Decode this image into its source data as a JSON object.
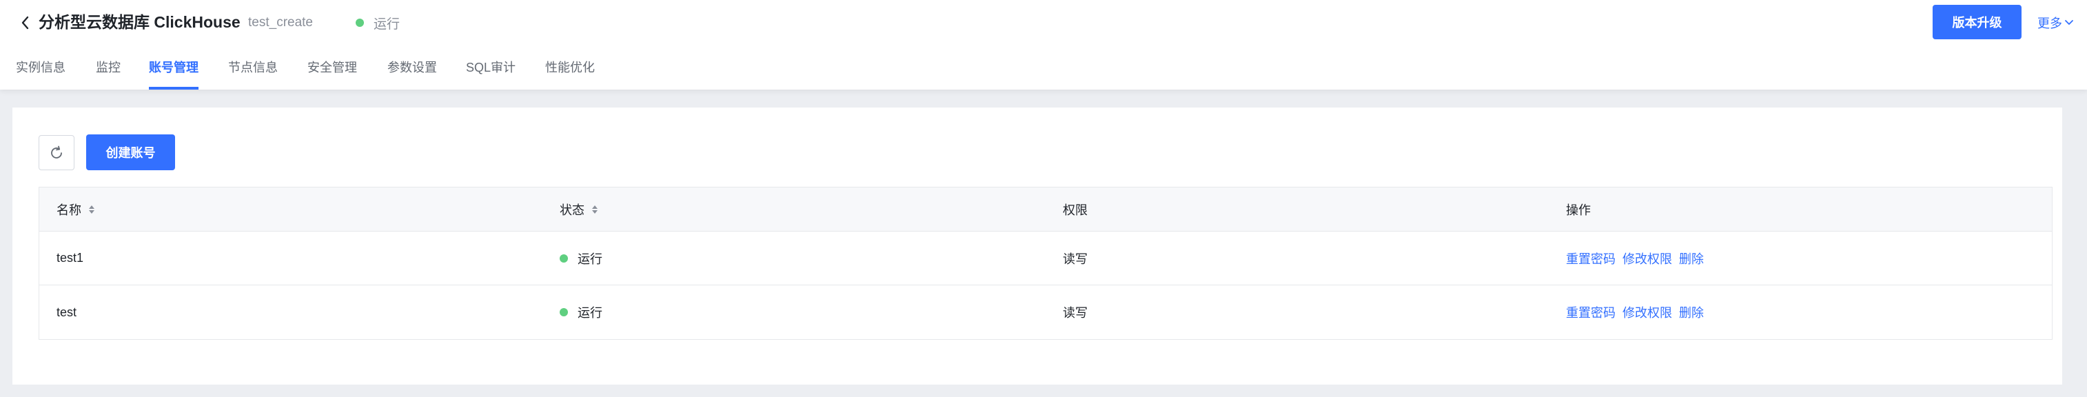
{
  "header": {
    "title": "分析型云数据库 ClickHouse",
    "instance_id": "test_create",
    "status": "运行",
    "status_color": "#5fcf80",
    "upgrade_label": "版本升级",
    "more_label": "更多"
  },
  "tabs": [
    {
      "label": "实例信息",
      "active": false
    },
    {
      "label": "监控",
      "active": false
    },
    {
      "label": "账号管理",
      "active": true
    },
    {
      "label": "节点信息",
      "active": false
    },
    {
      "label": "安全管理",
      "active": false
    },
    {
      "label": "参数设置",
      "active": false
    },
    {
      "label": "SQL审计",
      "active": false
    },
    {
      "label": "性能优化",
      "active": false
    }
  ],
  "toolbar": {
    "refresh_icon": "refresh-icon",
    "create_label": "创建账号"
  },
  "table": {
    "columns": [
      "名称",
      "状态",
      "权限",
      "操作"
    ],
    "rows": [
      {
        "name": "test1",
        "status": "运行",
        "permission": "读写",
        "actions": [
          "重置密码",
          "修改权限",
          "删除"
        ]
      },
      {
        "name": "test",
        "status": "运行",
        "permission": "读写",
        "actions": [
          "重置密码",
          "修改权限",
          "删除"
        ]
      }
    ]
  },
  "colors": {
    "accent": "#3370ff",
    "status_running": "#5fcf80",
    "page_bg": "#eceef2"
  }
}
